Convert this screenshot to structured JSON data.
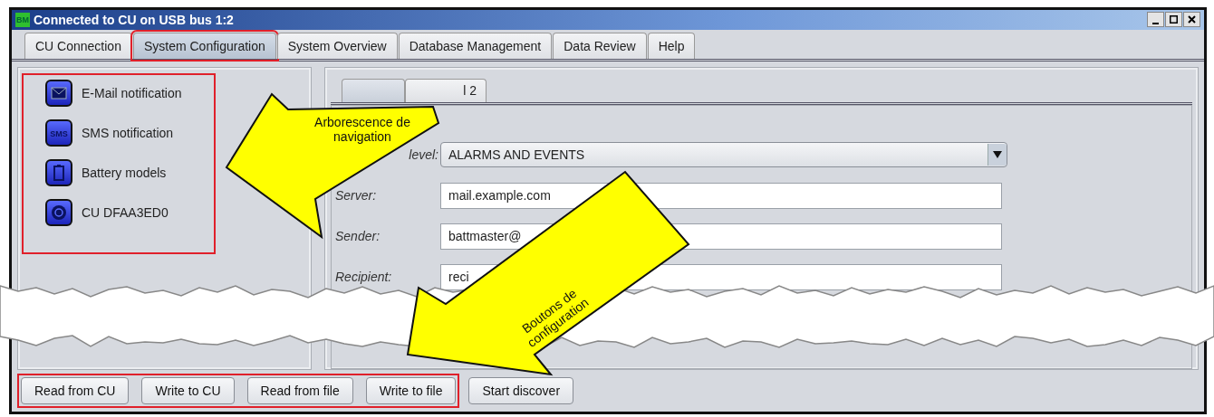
{
  "window": {
    "title": "Connected to CU on USB bus 1:2",
    "app_badge": "BM"
  },
  "tabs": [
    {
      "label": "CU Connection",
      "selected": false,
      "highlighted": false
    },
    {
      "label": "System Configuration",
      "selected": true,
      "highlighted": true
    },
    {
      "label": "System Overview",
      "selected": false,
      "highlighted": false
    },
    {
      "label": "Database Management",
      "selected": false,
      "highlighted": false
    },
    {
      "label": "Data Review",
      "selected": false,
      "highlighted": false
    },
    {
      "label": "Help",
      "selected": false,
      "highlighted": false
    }
  ],
  "navigation": {
    "highlighted": true,
    "items": [
      {
        "label": "E-Mail notification",
        "kind": "mail"
      },
      {
        "label": "SMS notification",
        "kind": "sms",
        "badge": "SMS"
      },
      {
        "label": "Battery models",
        "kind": "battery"
      },
      {
        "label": "CU DFAA3ED0",
        "kind": "device"
      }
    ]
  },
  "inner_tabs": [
    {
      "selected": true
    },
    {
      "label": "l 2",
      "selected": false
    }
  ],
  "form": {
    "fields": [
      {
        "kind": "dropdown",
        "label": "level:",
        "value": "ALARMS AND EVENTS"
      },
      {
        "kind": "text",
        "label": "Server:",
        "value": "mail.example.com"
      },
      {
        "kind": "text",
        "label": "Sender:",
        "value": "battmaster@"
      },
      {
        "kind": "text",
        "label": "Recipient:",
        "value": "reci"
      }
    ]
  },
  "buttons": [
    {
      "label": "Read from CU",
      "highlighted": true
    },
    {
      "label": "Write to CU",
      "highlighted": true
    },
    {
      "label": "Read from file",
      "highlighted": true
    },
    {
      "label": "Write to file",
      "highlighted": true
    },
    {
      "label": "Start discover",
      "highlighted": false
    }
  ],
  "annotations": [
    {
      "kind": "navigation",
      "text": "Arborescence de navigation"
    },
    {
      "kind": "buttons",
      "text": "Boutons de configuration"
    }
  ]
}
